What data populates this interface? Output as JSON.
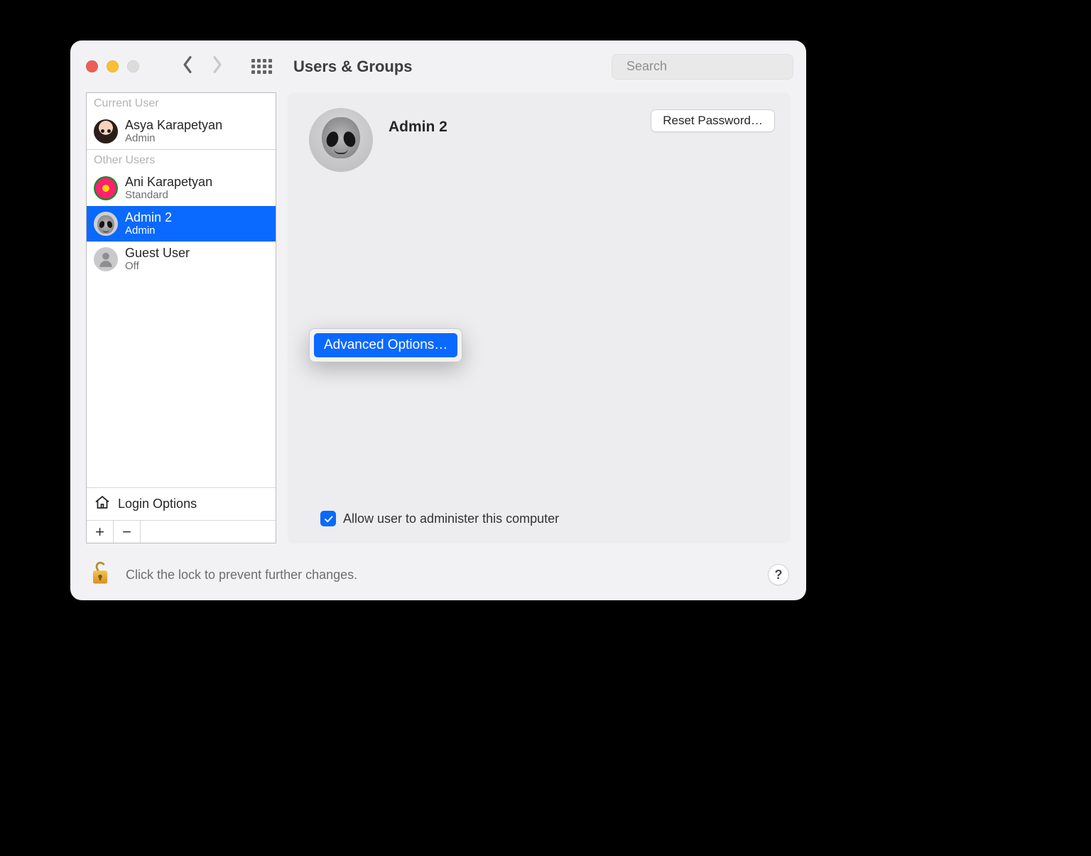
{
  "toolbar": {
    "title": "Users & Groups",
    "search_placeholder": "Search"
  },
  "sidebar": {
    "current_user_header": "Current User",
    "other_users_header": "Other Users",
    "current_user": {
      "name": "Asya Karapetyan",
      "role": "Admin"
    },
    "other_users": [
      {
        "name": "Ani Karapetyan",
        "role": "Standard"
      },
      {
        "name": "Admin 2",
        "role": "Admin"
      },
      {
        "name": "Guest User",
        "role": "Off"
      }
    ],
    "login_options_label": "Login Options"
  },
  "content": {
    "selected_user_name": "Admin 2",
    "reset_password_label": "Reset Password…",
    "admin_checkbox_label": "Allow user to administer this computer"
  },
  "context_menu": {
    "advanced_options_label": "Advanced Options…"
  },
  "footer": {
    "lock_hint": "Click the lock to prevent further changes."
  }
}
